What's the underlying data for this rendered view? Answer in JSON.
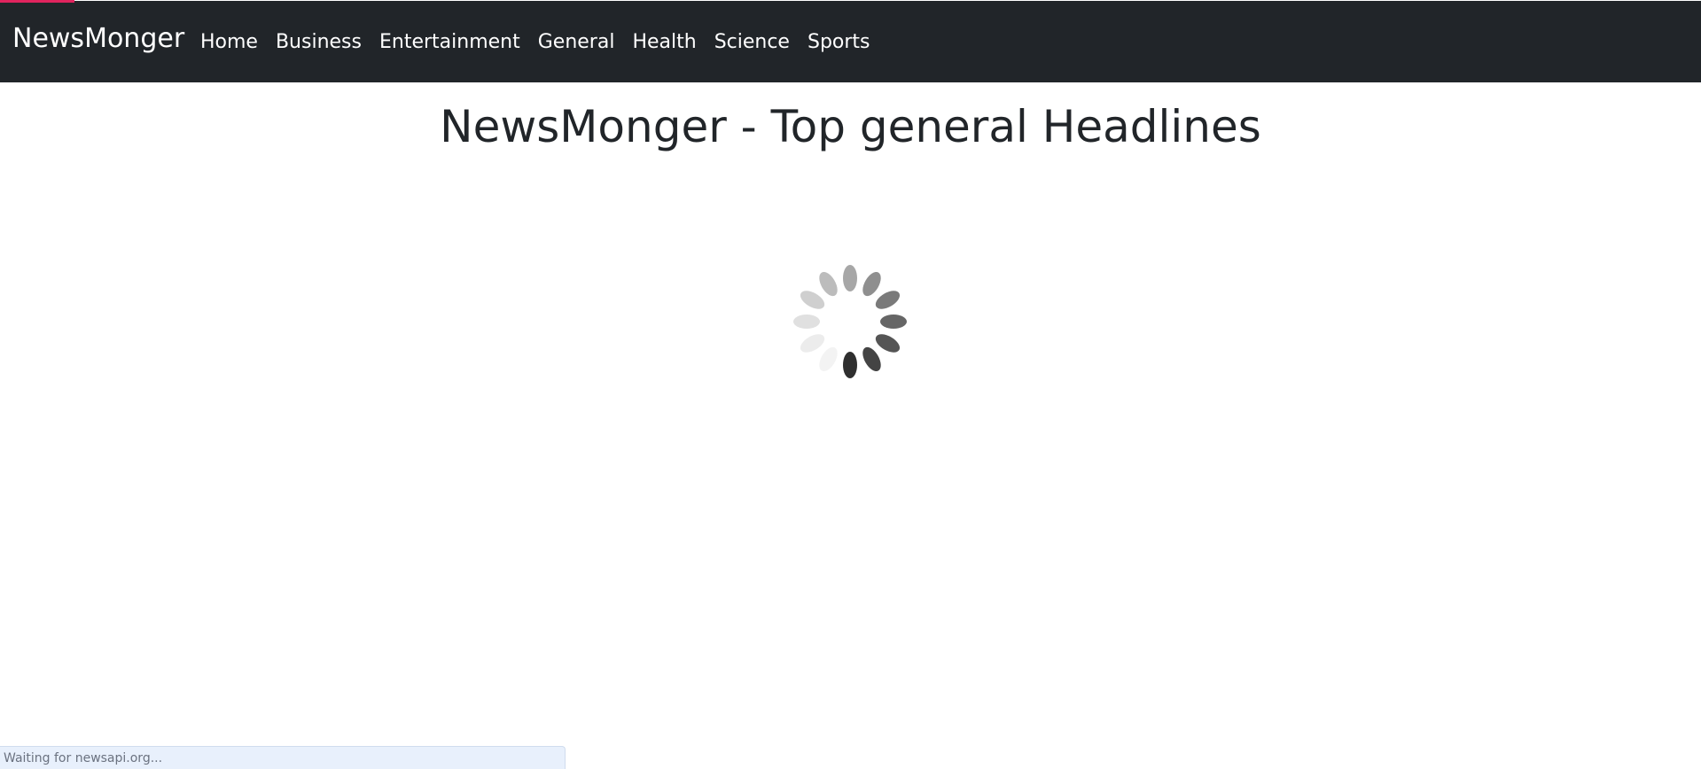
{
  "navbar": {
    "brand": "NewsMonger",
    "links": [
      {
        "label": "Home"
      },
      {
        "label": "Business"
      },
      {
        "label": "Entertainment"
      },
      {
        "label": "General"
      },
      {
        "label": "Health"
      },
      {
        "label": "Science"
      },
      {
        "label": "Sports"
      }
    ],
    "background_color": "#212529"
  },
  "main": {
    "title": "NewsMonger - Top general Headlines",
    "spinner_icon": "loading-spinner-icon"
  },
  "status_bar": {
    "text": "Waiting for newsapi.org..."
  },
  "colors": {
    "accent_progress": "#e0245e",
    "title_text": "#212529"
  }
}
